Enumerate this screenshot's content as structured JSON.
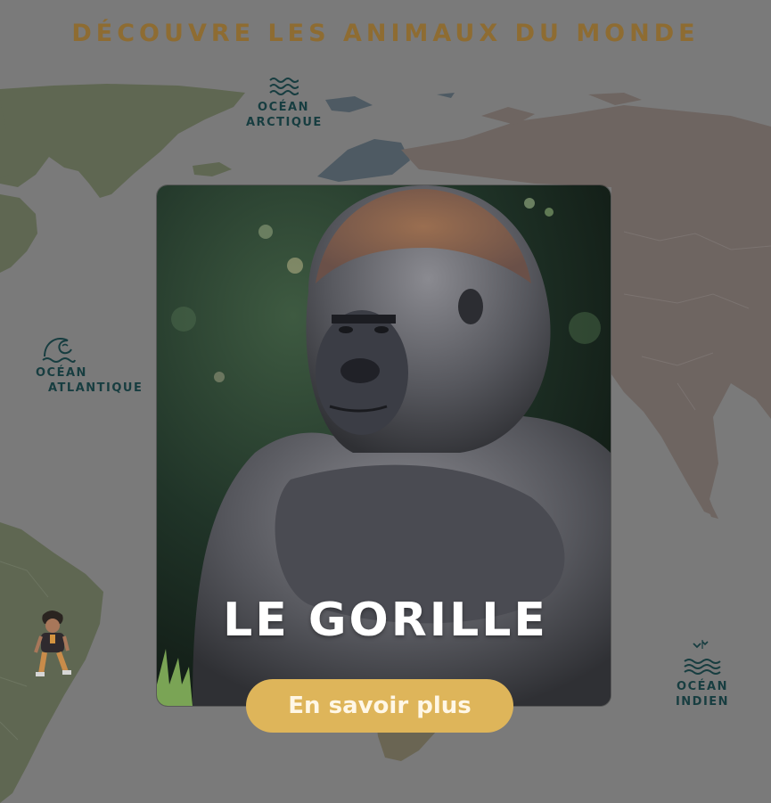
{
  "page": {
    "title": "DÉCOUVRE LES ANIMAUX DU MONDE"
  },
  "oceans": {
    "arctic": {
      "line1": "OCÉAN",
      "line2": "ARCTIQUE",
      "icon": "waves-icon"
    },
    "atlantic": {
      "line1": "OCÉAN",
      "line2": "ATLANTIQUE",
      "icon": "wave-crest-icon"
    },
    "indian": {
      "line1": "OCÉAN",
      "line2": "INDIEN",
      "icon": "waves-birds-icon"
    }
  },
  "card": {
    "animal_name": "LE GORILLE",
    "cta_label": "En savoir plus",
    "image": "gorilla-photo"
  },
  "colors": {
    "background": "#7a7a7a",
    "title": "#8e6c32",
    "ocean_label": "#173d40",
    "cta_bg": "#deb55a",
    "america": "#5f6752",
    "eurasia": "#6e6561",
    "africa": "#6a6553"
  }
}
